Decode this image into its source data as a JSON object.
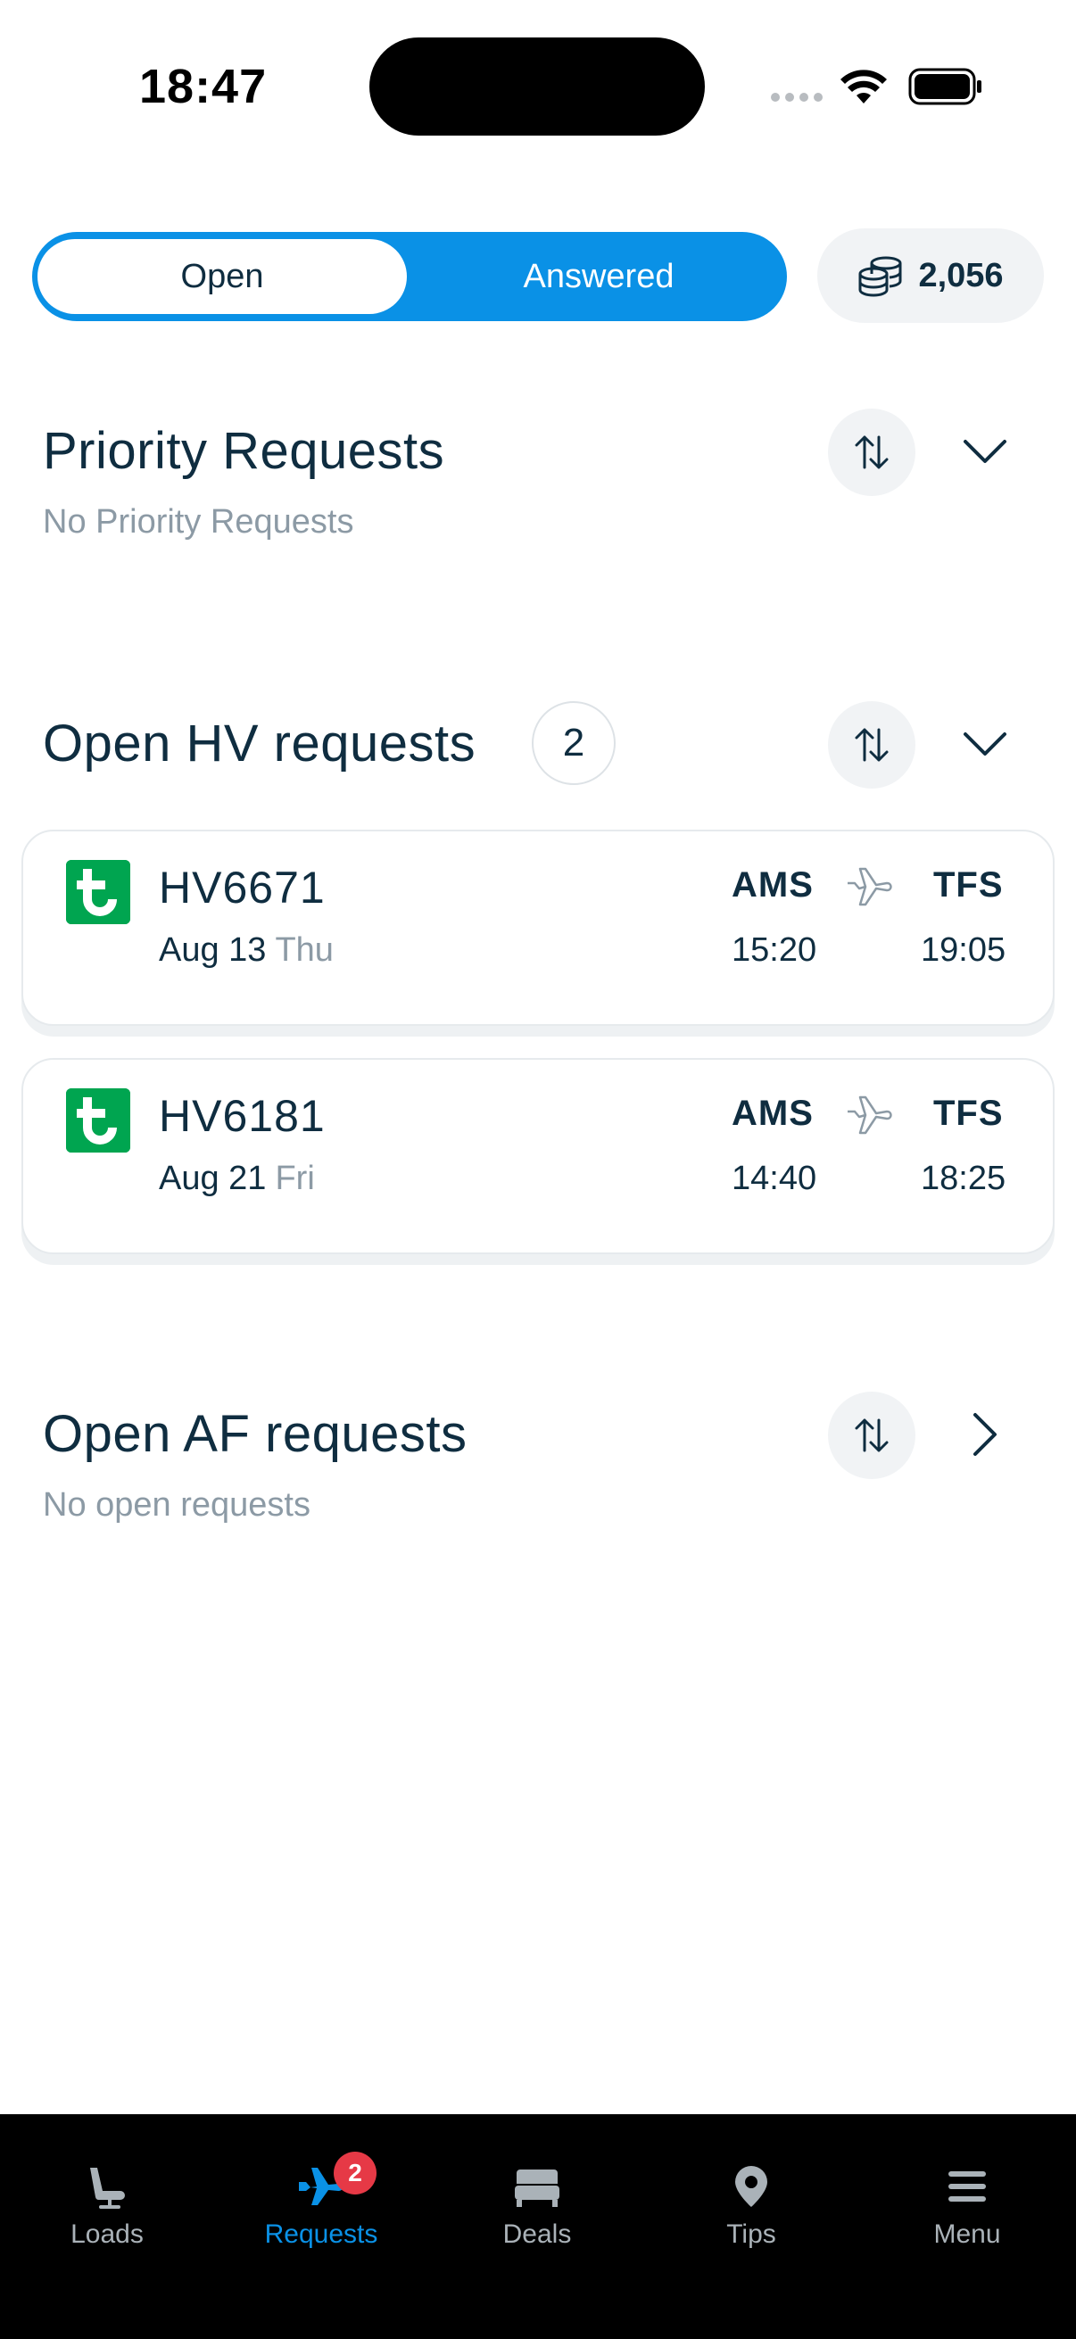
{
  "status_bar": {
    "time": "18:47"
  },
  "segment": {
    "open_label": "Open",
    "answered_label": "Answered"
  },
  "points": {
    "value": "2,056",
    "icon": "coins-icon"
  },
  "priority": {
    "title": "Priority Requests",
    "subtitle": "No Priority Requests"
  },
  "hv": {
    "title": "Open HV requests",
    "count": "2",
    "flights": [
      {
        "number": "HV6671",
        "date": "Aug 13",
        "day": "Thu",
        "from": "AMS",
        "to": "TFS",
        "dep": "15:20",
        "arr": "19:05"
      },
      {
        "number": "HV6181",
        "date": "Aug 21",
        "day": "Fri",
        "from": "AMS",
        "to": "TFS",
        "dep": "14:40",
        "arr": "18:25"
      }
    ]
  },
  "af": {
    "title": "Open AF requests",
    "subtitle": "No open requests"
  },
  "tabbar": {
    "items": [
      {
        "label": "Loads",
        "icon": "seat-icon"
      },
      {
        "label": "Requests",
        "icon": "plane-icon",
        "badge": "2",
        "active": true
      },
      {
        "label": "Deals",
        "icon": "bed-icon"
      },
      {
        "label": "Tips",
        "icon": "pin-icon"
      },
      {
        "label": "Menu",
        "icon": "menu-icon"
      }
    ]
  },
  "colors": {
    "accent": "#0a91e6",
    "text": "#0f2d40",
    "muted": "#8c9aa5",
    "airline": "#00a550",
    "badge": "#e63946"
  }
}
